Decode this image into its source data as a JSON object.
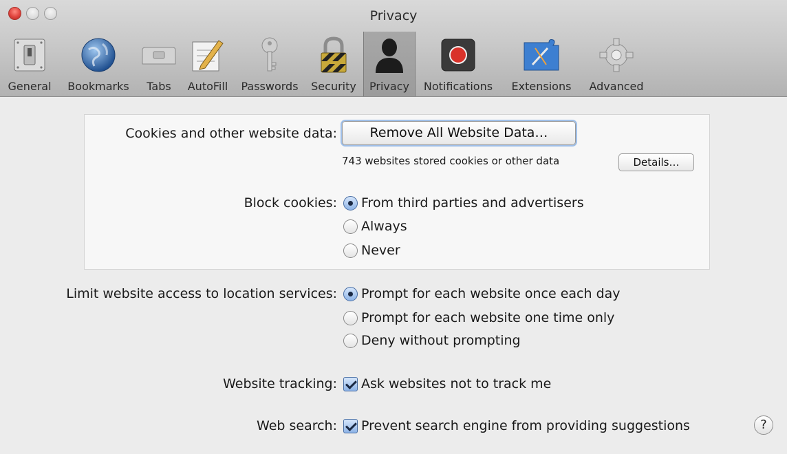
{
  "window": {
    "title": "Privacy"
  },
  "toolbar": {
    "items": [
      {
        "label": "General",
        "icon": "switch-icon"
      },
      {
        "label": "Bookmarks",
        "icon": "globe-icon"
      },
      {
        "label": "Tabs",
        "icon": "tabs-icon"
      },
      {
        "label": "AutoFill",
        "icon": "pencil-form-icon"
      },
      {
        "label": "Passwords",
        "icon": "key-icon"
      },
      {
        "label": "Security",
        "icon": "padlock-icon"
      },
      {
        "label": "Privacy",
        "icon": "person-silhouette-icon",
        "selected": true
      },
      {
        "label": "Notifications",
        "icon": "record-dot-icon"
      },
      {
        "label": "Extensions",
        "icon": "puzzle-compass-icon"
      },
      {
        "label": "Advanced",
        "icon": "gear-icon"
      }
    ]
  },
  "cookies": {
    "label": "Cookies and other website data:",
    "remove_button": "Remove All Website Data…",
    "stored_text": "743 websites stored cookies or other data",
    "details_button": "Details…"
  },
  "block_cookies": {
    "label": "Block cookies:",
    "options": [
      {
        "label": "From third parties and advertisers",
        "selected": true
      },
      {
        "label": "Always",
        "selected": false
      },
      {
        "label": "Never",
        "selected": false
      }
    ]
  },
  "location": {
    "label": "Limit website access to location services:",
    "options": [
      {
        "label": "Prompt for each website once each day",
        "selected": true
      },
      {
        "label": "Prompt for each website one time only",
        "selected": false
      },
      {
        "label": "Deny without prompting",
        "selected": false
      }
    ]
  },
  "tracking": {
    "label": "Website tracking:",
    "checkbox": "Ask websites not to track me",
    "checked": true
  },
  "web_search": {
    "label": "Web search:",
    "checkbox": "Prevent search engine from providing suggestions",
    "checked": true
  },
  "help": {
    "label": "?"
  },
  "colors": {
    "accent": "#4a6fa4",
    "panel_bg": "#f7f7f7",
    "window_bg": "#ececec"
  }
}
